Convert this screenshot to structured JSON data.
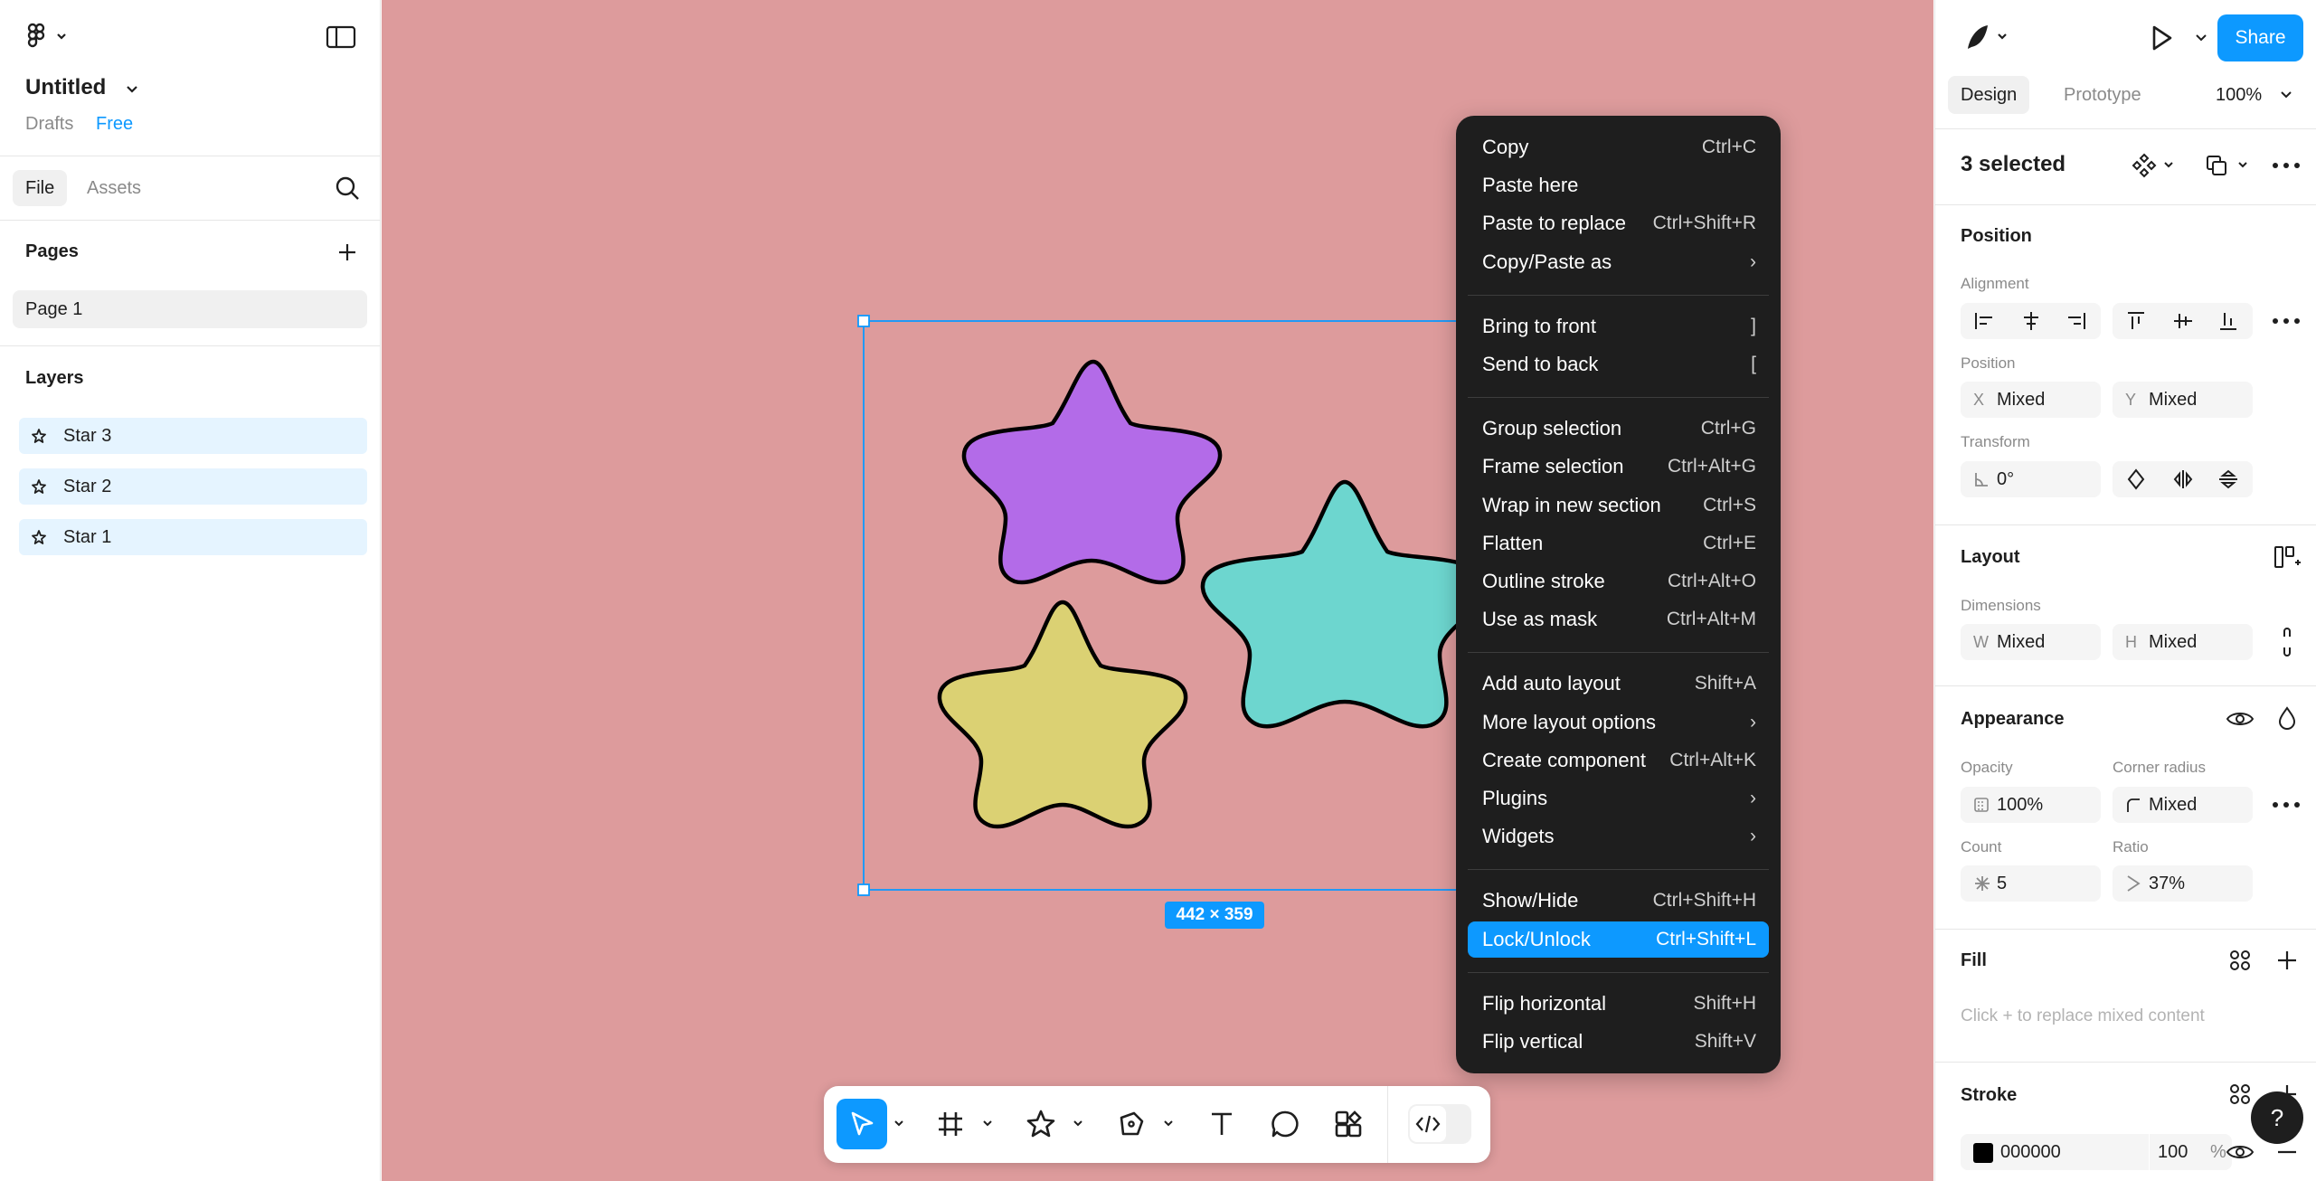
{
  "left_panel": {
    "file_name": "Untitled",
    "location": "Drafts",
    "plan": "Free",
    "tabs": [
      "File",
      "Assets"
    ],
    "pages_heading": "Pages",
    "pages": [
      "Page 1"
    ],
    "layers_heading": "Layers",
    "layers": [
      "Star 3",
      "Star 2",
      "Star 1"
    ]
  },
  "canvas": {
    "background": "#dd9b9c",
    "selection_size": "442 × 359",
    "stars": [
      {
        "name": "Star 3",
        "fill": "#b36be8"
      },
      {
        "name": "Star 2",
        "fill": "#6dd6cf"
      },
      {
        "name": "Star 1",
        "fill": "#dbd173"
      }
    ]
  },
  "context_menu": {
    "groups": [
      [
        {
          "label": "Copy",
          "shortcut": "Ctrl+C"
        },
        {
          "label": "Paste here",
          "shortcut": ""
        },
        {
          "label": "Paste to replace",
          "shortcut": "Ctrl+Shift+R"
        },
        {
          "label": "Copy/Paste as",
          "shortcut": "›"
        }
      ],
      [
        {
          "label": "Bring to front",
          "shortcut": "]"
        },
        {
          "label": "Send to back",
          "shortcut": "["
        }
      ],
      [
        {
          "label": "Group selection",
          "shortcut": "Ctrl+G"
        },
        {
          "label": "Frame selection",
          "shortcut": "Ctrl+Alt+G"
        },
        {
          "label": "Wrap in new section",
          "shortcut": "Ctrl+S"
        },
        {
          "label": "Flatten",
          "shortcut": "Ctrl+E"
        },
        {
          "label": "Outline stroke",
          "shortcut": "Ctrl+Alt+O"
        },
        {
          "label": "Use as mask",
          "shortcut": "Ctrl+Alt+M"
        }
      ],
      [
        {
          "label": "Add auto layout",
          "shortcut": "Shift+A"
        },
        {
          "label": "More layout options",
          "shortcut": "›"
        },
        {
          "label": "Create component",
          "shortcut": "Ctrl+Alt+K"
        },
        {
          "label": "Plugins",
          "shortcut": "›"
        },
        {
          "label": "Widgets",
          "shortcut": "›"
        }
      ],
      [
        {
          "label": "Show/Hide",
          "shortcut": "Ctrl+Shift+H"
        },
        {
          "label": "Lock/Unlock",
          "shortcut": "Ctrl+Shift+L"
        }
      ],
      [
        {
          "label": "Flip horizontal",
          "shortcut": "Shift+H"
        },
        {
          "label": "Flip vertical",
          "shortcut": "Shift+V"
        }
      ]
    ],
    "highlighted": "Lock/Unlock"
  },
  "toolbar": {
    "tools": [
      "move-tool",
      "frame-tool",
      "shape-tool",
      "pen-tool",
      "text-tool",
      "comment-tool",
      "actions-tool",
      "dev-mode-toggle"
    ],
    "active": "move-tool"
  },
  "right_panel": {
    "share_label": "Share",
    "tabs": [
      "Design",
      "Prototype"
    ],
    "zoom": "100%",
    "selection_label": "3 selected",
    "position_heading": "Position",
    "alignment_label": "Alignment",
    "position_label": "Position",
    "x_prefix": "X",
    "x_value": "Mixed",
    "y_prefix": "Y",
    "y_value": "Mixed",
    "transform_label": "Transform",
    "rotation": "0°",
    "layout_heading": "Layout",
    "dimensions_label": "Dimensions",
    "w_prefix": "W",
    "w_value": "Mixed",
    "h_prefix": "H",
    "h_value": "Mixed",
    "appearance_heading": "Appearance",
    "opacity_label": "Opacity",
    "opacity_value": "100%",
    "corner_radius_label": "Corner radius",
    "corner_radius_value": "Mixed",
    "count_label": "Count",
    "count_value": "5",
    "ratio_label": "Ratio",
    "ratio_value": "37%",
    "fill_heading": "Fill",
    "fill_placeholder": "Click + to replace mixed content",
    "stroke_heading": "Stroke",
    "stroke_color": "000000",
    "stroke_opacity": "100",
    "stroke_opacity_unit": "%",
    "help_label": "?"
  }
}
